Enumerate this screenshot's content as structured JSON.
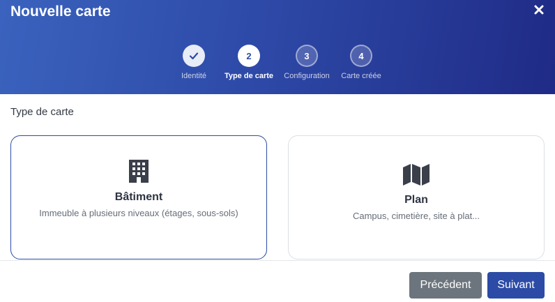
{
  "dialog": {
    "title": "Nouvelle carte"
  },
  "stepper": {
    "steps": [
      {
        "number": "✓",
        "label": "Identité",
        "state": "done"
      },
      {
        "number": "2",
        "label": "Type de carte",
        "state": "active"
      },
      {
        "number": "3",
        "label": "Configuration",
        "state": "pending"
      },
      {
        "number": "4",
        "label": "Carte créée",
        "state": "pending"
      }
    ]
  },
  "section": {
    "title": "Type de carte"
  },
  "options": [
    {
      "icon": "building-icon",
      "title": "Bâtiment",
      "description": "Immeuble à plusieurs niveaux (étages, sous-sols)",
      "selected": true
    },
    {
      "icon": "map-icon",
      "title": "Plan",
      "description": "Campus, cimetière, site à plat...",
      "selected": false
    }
  ],
  "footer": {
    "previous_label": "Précédent",
    "next_label": "Suivant"
  },
  "colors": {
    "primary": "#2c4ba6",
    "secondary": "#6c757d",
    "header_gradient_start": "#3a63be",
    "header_gradient_end": "#1f2b86"
  }
}
